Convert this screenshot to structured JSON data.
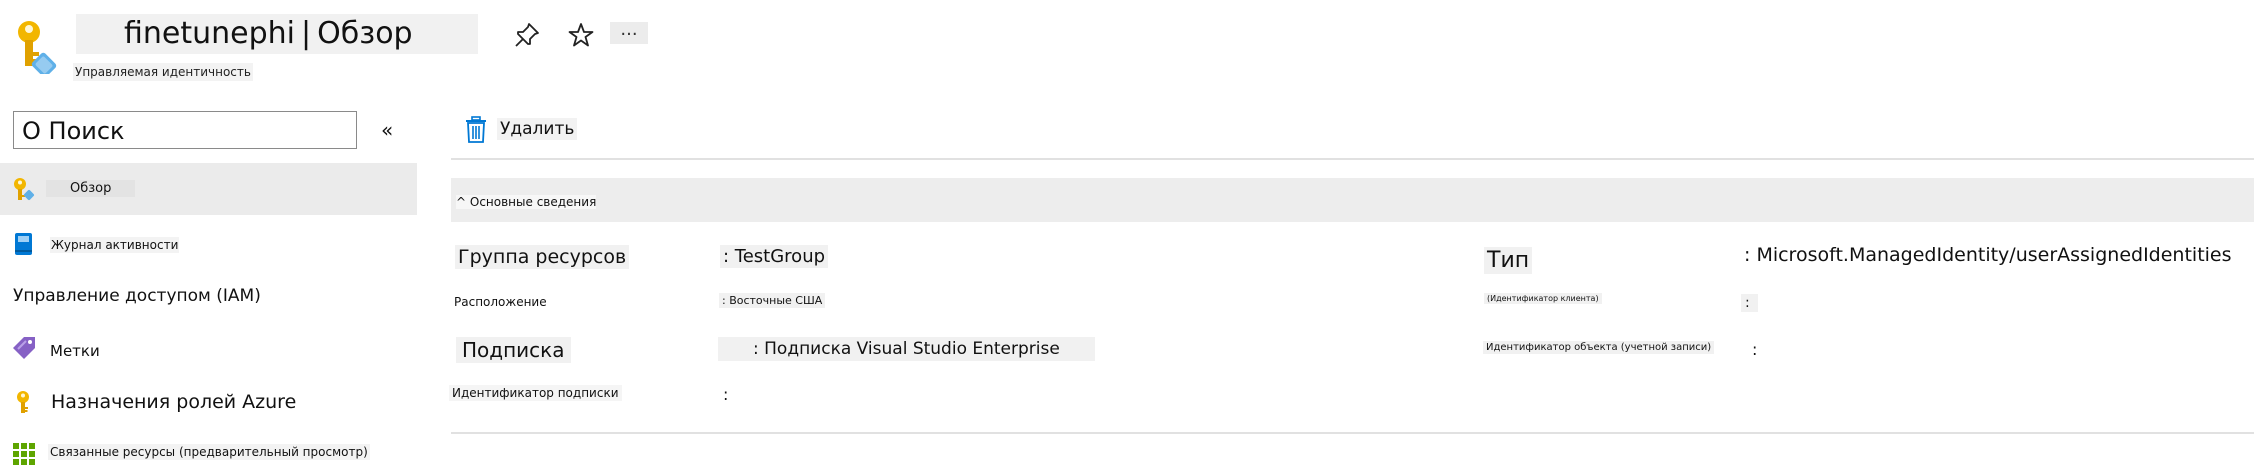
{
  "header": {
    "resource_name": "finetunephi",
    "separator": "|",
    "blade_name": "Обзор",
    "subtitle": "Управляемая идентичность",
    "more_label": "...",
    "icons": [
      "managed-identity-key-icon",
      "pin-icon",
      "star-icon"
    ]
  },
  "sidebar": {
    "search_prefix": "О",
    "search_placeholder": "Поиск",
    "collapse_label": "«",
    "items": [
      {
        "label": "Обзор",
        "icon": "key-icon",
        "active": true
      },
      {
        "label": "Журнал активности",
        "icon": "book-icon"
      },
      {
        "label": "Управление доступом (IAM)",
        "icon": ""
      },
      {
        "label": "Метки",
        "icon": "tag-icon"
      },
      {
        "label": "Назначения ролей Azure",
        "icon": "key-icon"
      },
      {
        "label": "Связанные ресурсы (предварительный просмотр)",
        "icon": "grid-icon"
      }
    ]
  },
  "toolbar": {
    "delete_label": "Удалить"
  },
  "essentials": {
    "toggle_label": "^ Основные сведения",
    "left": [
      {
        "label": "Группа ресурсов",
        "value": ": TestGroup"
      },
      {
        "label": "Расположение",
        "value": ": Восточные США"
      },
      {
        "label": "Подписка",
        "value": ": Подписка Visual Studio Enterprise"
      },
      {
        "label": "Идентификатор подписки",
        "value": ":"
      }
    ],
    "right": [
      {
        "label": "Тип",
        "value": ": Microsoft.ManagedIdentity/userAssignedIdentities"
      },
      {
        "label": "(Идентификатор клиента)",
        "value": ":"
      },
      {
        "label": "Идентификатор объекта (учетной записи)",
        "value": ":"
      }
    ]
  },
  "colors": {
    "accent": "#0078d4",
    "key": "#f2b600",
    "tag": "#8661c5",
    "grid": "#5ea500"
  }
}
